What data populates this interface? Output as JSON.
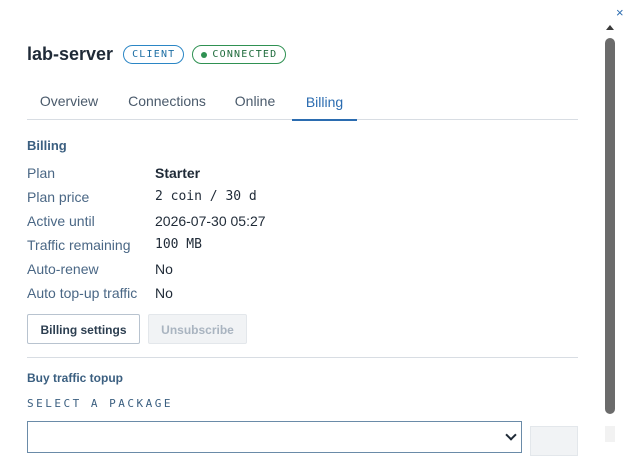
{
  "window": {
    "close_glyph": "×"
  },
  "header": {
    "title": "lab-server",
    "badge_client": "CLIENT",
    "badge_connected": "CONNECTED"
  },
  "tabs": [
    {
      "label": "Overview",
      "active": false
    },
    {
      "label": "Connections",
      "active": false
    },
    {
      "label": "Online",
      "active": false
    },
    {
      "label": "Billing",
      "active": true
    }
  ],
  "billing": {
    "section_title": "Billing",
    "rows": [
      {
        "key": "Plan",
        "value": "Starter"
      },
      {
        "key": "Plan price",
        "value": "2 coin / 30 d"
      },
      {
        "key": "Active until",
        "value": "2026-07-30 05:27"
      },
      {
        "key": "Traffic remaining",
        "value": "100 MB"
      },
      {
        "key": "Auto-renew",
        "value": "No"
      },
      {
        "key": "Auto top-up traffic",
        "value": "No"
      }
    ],
    "settings_button": "Billing settings",
    "unsubscribe_button": "Unsubscribe"
  },
  "topup": {
    "title": "Buy traffic topup",
    "package_label": "SELECT A PACKAGE",
    "selected_value": "",
    "buy_button": ""
  },
  "colors": {
    "accent": "#2b6cb0",
    "connected": "#2f9152",
    "label": "#4a6785"
  },
  "icons": {
    "close": "close-icon",
    "chevron": "chevron-down-icon",
    "status_dot": "status-dot-icon"
  }
}
